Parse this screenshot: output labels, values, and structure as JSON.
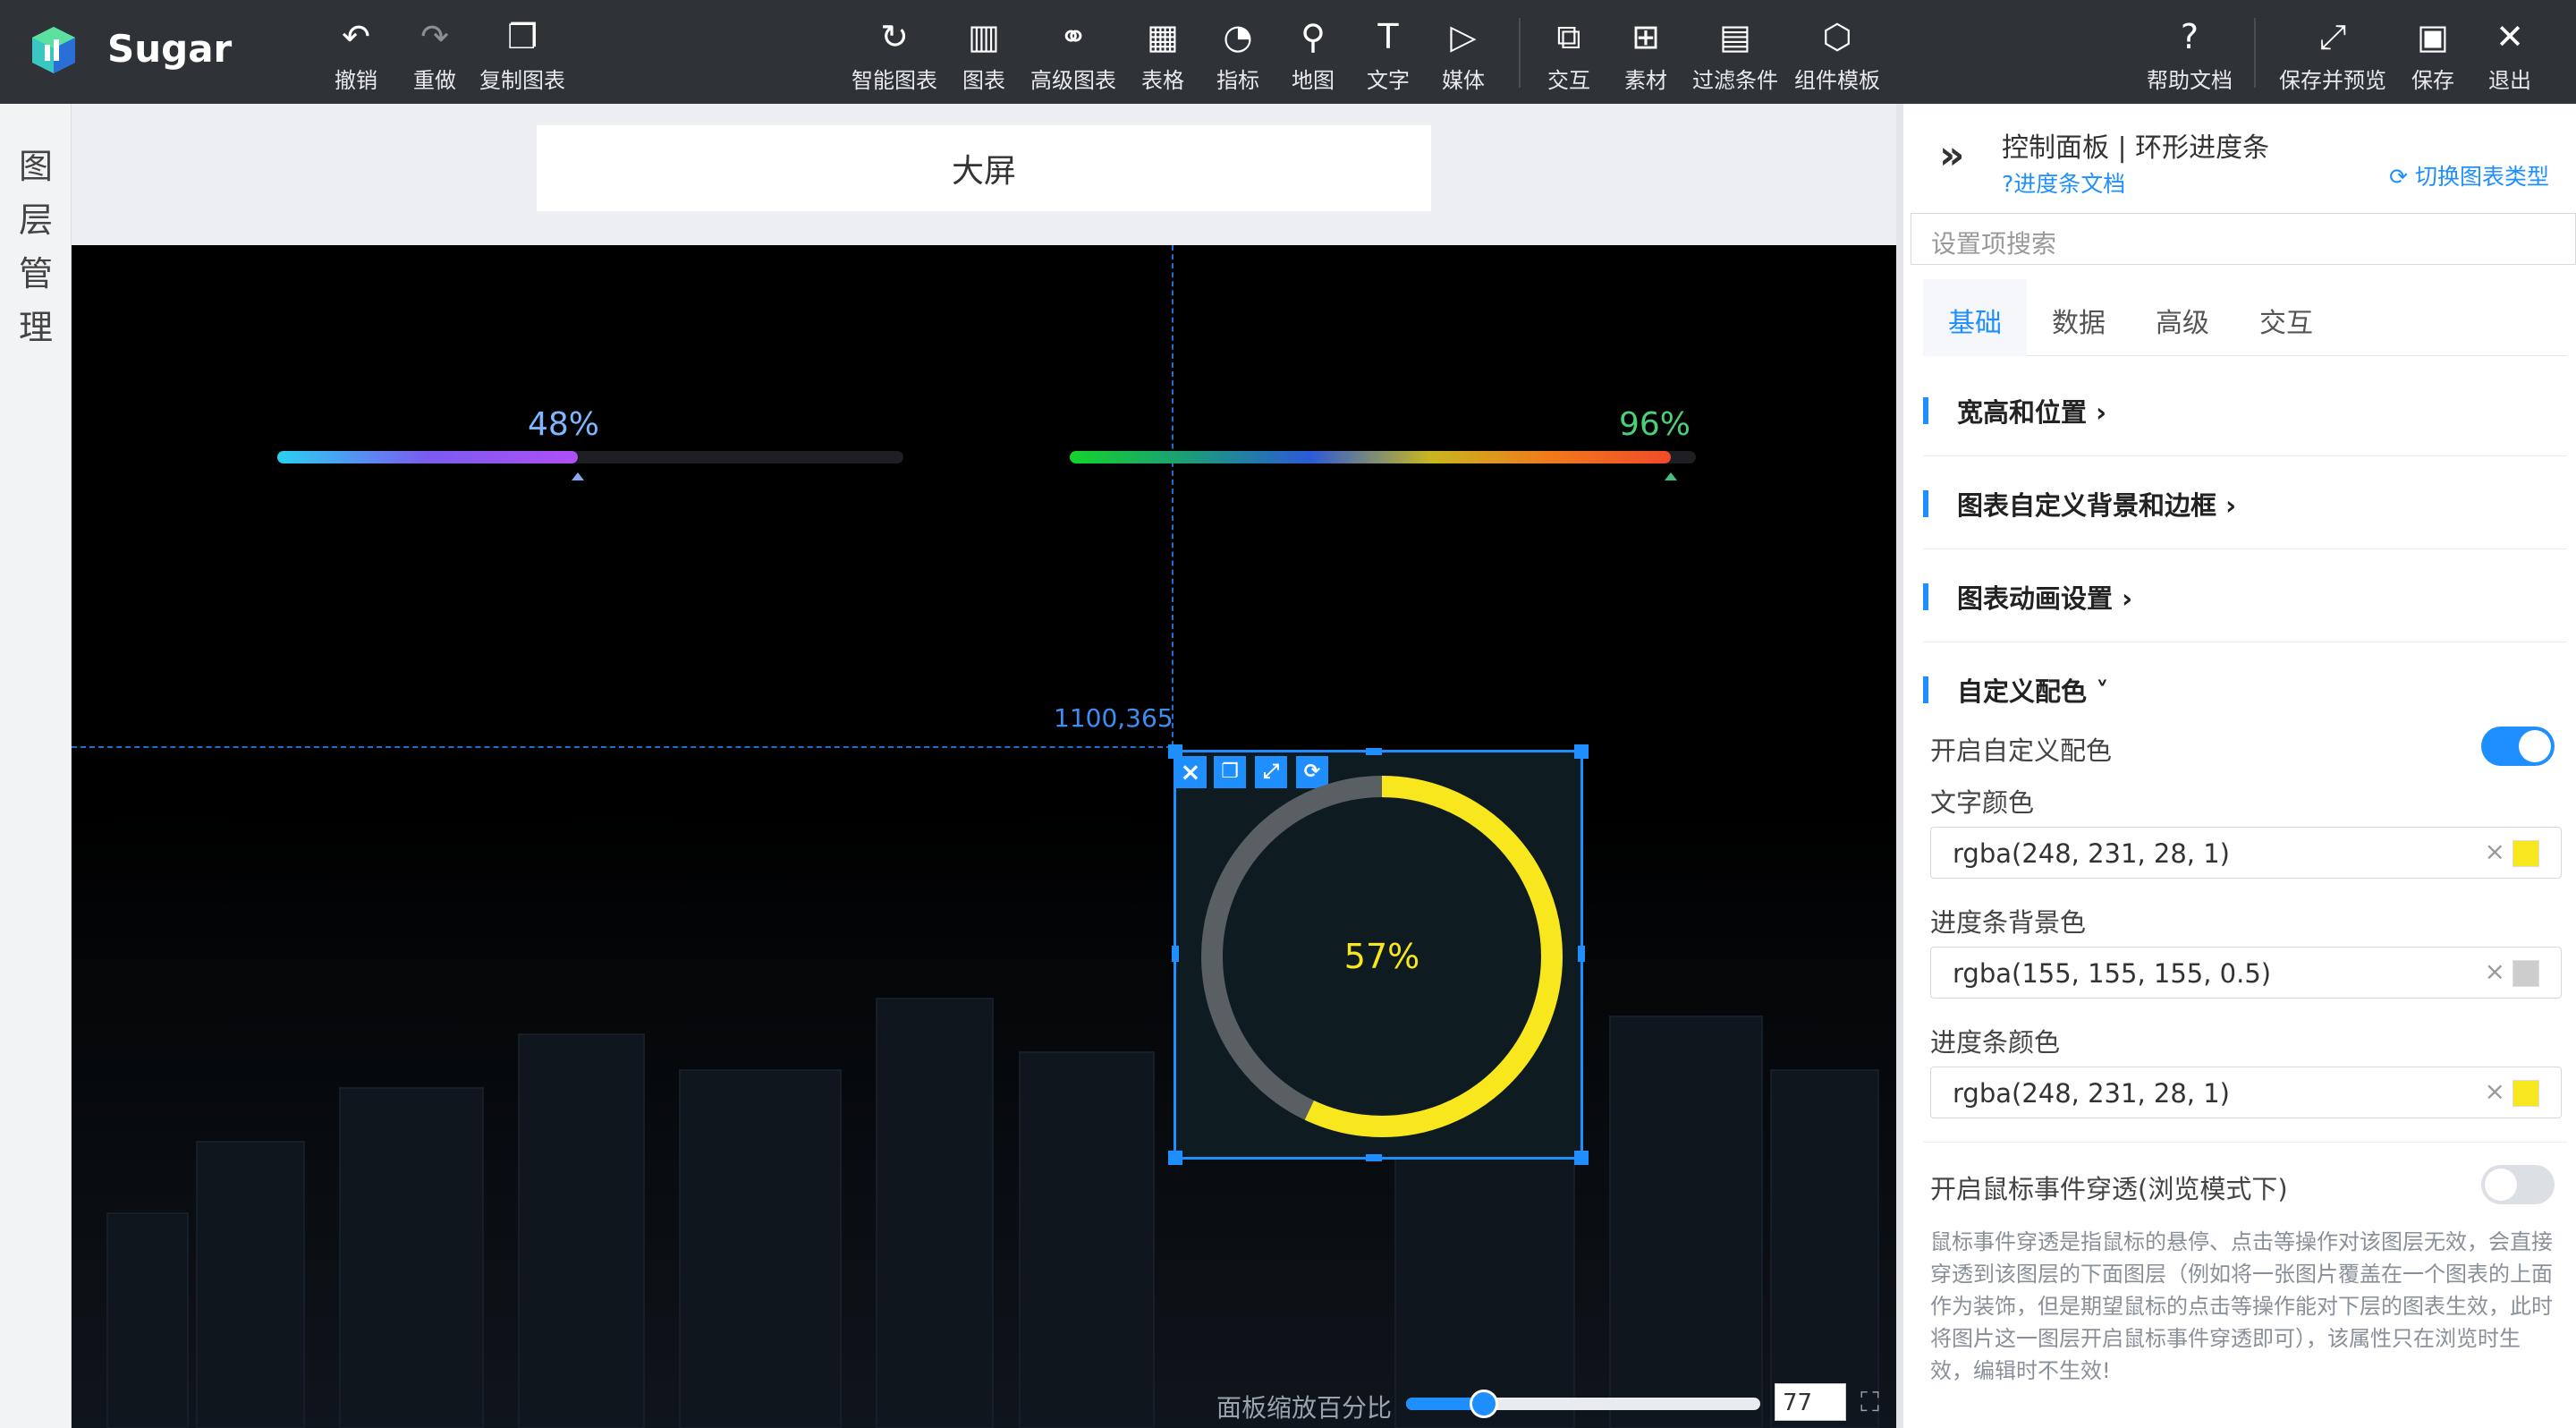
{
  "app": {
    "brand": "Sugar"
  },
  "toolbar": {
    "undo": "撤销",
    "redo": "重做",
    "copy_chart": "复制图表",
    "smart_chart": "智能图表",
    "chart": "图表",
    "advanced_chart": "高级图表",
    "table": "表格",
    "indicator": "指标",
    "map": "地图",
    "text": "文字",
    "media": "媒体",
    "interaction": "交互",
    "material": "素材",
    "filter": "过滤条件",
    "component_template": "组件模板",
    "help": "帮助文档",
    "save_preview": "保存并预览",
    "save": "保存",
    "exit": "退出"
  },
  "rail": {
    "label": "图层管理"
  },
  "canvas": {
    "title": "大屏",
    "coord_readout": "1100,365",
    "bar1": {
      "label": "48%",
      "progress": 0.48
    },
    "bar2": {
      "label": "96%",
      "progress": 0.96
    },
    "ring": {
      "label": "57%",
      "progress": 0.57,
      "ring_color": "#f8e71c",
      "track_color": "#5a5f63"
    },
    "zoom": {
      "label": "面板缩放百分比",
      "value": "77",
      "progress": 0.22
    }
  },
  "panel": {
    "title": "控制面板 | 环形进度条",
    "doc_link": "?进度条文档",
    "switch_link": "切换图表类型",
    "search_placeholder": "设置项搜索",
    "tabs": [
      "基础",
      "数据",
      "高级",
      "交互"
    ],
    "sections": [
      "宽高和位置",
      "图表自定义背景和边框",
      "图表动画设置",
      "自定义配色"
    ],
    "custom_color_toggle_label": "开启自定义配色",
    "custom_color_on": true,
    "text_color_label": "文字颜色",
    "text_color_value": "rgba(248, 231, 28, 1)",
    "bar_bg_label": "进度条背景色",
    "bar_bg_value": "rgba(155, 155, 155, 0.5)",
    "bar_color_label": "进度条颜色",
    "bar_color_value": "rgba(248, 231, 28, 1)",
    "mouse_through_label": "开启鼠标事件穿透(浏览模式下)",
    "mouse_through_on": false,
    "mouse_through_desc": "鼠标事件穿透是指鼠标的悬停、点击等操作对该图层无效，会直接穿透到该图层的下面图层（例如将一张图片覆盖在一个图表的上面作为装饰，但是期望鼠标的点击等操作能对下层的图表生效，此时将图片这一图层开启鼠标事件穿透即可），该属性只在浏览时生效，编辑时不生效!"
  },
  "colors": {
    "accent": "#1f8fff",
    "yellow": "#f8e71c"
  }
}
